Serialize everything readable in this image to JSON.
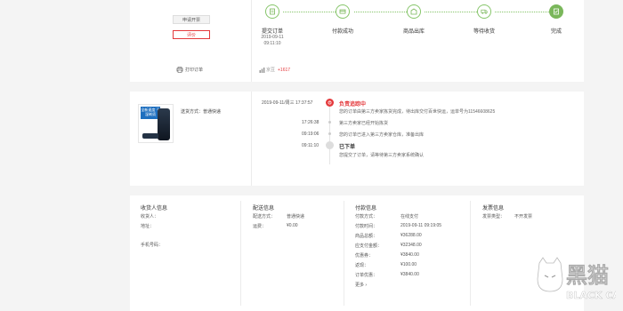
{
  "actions": {
    "invoice_label": "申请开票",
    "review_label": "评价",
    "print_label": "打印订单"
  },
  "progress": {
    "steps": [
      {
        "label": "提交订单",
        "date": "2019-09-11",
        "time": "09:11:10"
      },
      {
        "label": "付款成功"
      },
      {
        "label": "商品出库"
      },
      {
        "label": "等待收货"
      },
      {
        "label": "完成"
      }
    ],
    "current_step": 5,
    "accent": "#7ab75b"
  },
  "points": {
    "label": "京豆",
    "value": "+1617"
  },
  "shipping": {
    "method": "送货方式：普通快递"
  },
  "product_image": {
    "banner_text": "全新速度 干湿剃须"
  },
  "timeline": [
    {
      "datetime": "2019-09-11/周三   17:37:57",
      "title": "负责追踪中",
      "message": "您的订单由第三方卖家拣货完成，待出库交付百世快运，运单号为11546608625"
    },
    {
      "datetime": "17:26:38",
      "message": "第三方卖家已经开始拣货"
    },
    {
      "datetime": "09:19:06",
      "message": "您的订单已进入第三方卖家仓库，准备出库"
    },
    {
      "datetime": "09:11:10",
      "title": "已下单",
      "message": "您提交了订单，请等待第三方卖家系统确认"
    }
  ],
  "receiver": {
    "title": "收货人信息",
    "name_label": "收货人：",
    "address_label": "地址：",
    "phone_label": "手机号码："
  },
  "delivery": {
    "title": "配送信息",
    "method_label": "配送方式：",
    "method_value": "普通快递",
    "fee_label": "运费：",
    "fee_value": "¥0.00"
  },
  "payment": {
    "title": "付款信息",
    "rows": [
      {
        "label": "付款方式：",
        "value": "在线支付"
      },
      {
        "label": "付款时间：",
        "value": "2019-09-11 09:19:05"
      },
      {
        "label": "商品总额：",
        "value": "¥36288.00"
      },
      {
        "label": "应支付金额：",
        "value": "¥32348.00"
      },
      {
        "label": "优惠券：",
        "value": "¥3840.00"
      },
      {
        "label": "返现：",
        "value": "¥100.00"
      },
      {
        "label": "订单优惠：",
        "value": "¥3840.00"
      }
    ],
    "more_label": "更多 ›"
  },
  "invoice": {
    "title": "发票信息",
    "type_label": "发票类型：",
    "type_value": "不开发票"
  },
  "watermark": {
    "cn": "黑猫",
    "en": "BLACK CAT"
  }
}
